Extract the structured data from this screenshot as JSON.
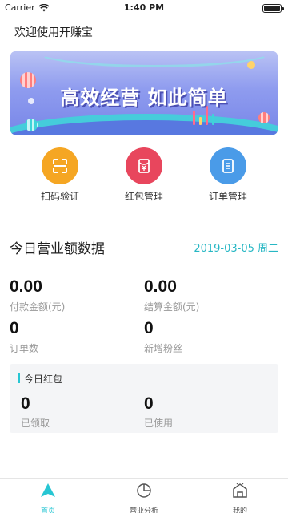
{
  "status_bar": {
    "carrier": "Carrier",
    "time": "1:40 PM"
  },
  "header": {
    "welcome": "欢迎使用开赚宝"
  },
  "banner": {
    "headline": "高效经营 如此简单"
  },
  "quick_actions": [
    {
      "label": "扫码验证",
      "icon": "scan-icon",
      "color": "#f5a623"
    },
    {
      "label": "红包管理",
      "icon": "red-packet-icon",
      "color": "#e8465d"
    },
    {
      "label": "订单管理",
      "icon": "order-list-icon",
      "color": "#4a9be8"
    }
  ],
  "today": {
    "title": "今日营业额数据",
    "date": "2019-03-05 周二",
    "stats": [
      {
        "value": "0.00",
        "label": "付款金额(元)"
      },
      {
        "value": "0.00",
        "label": "结算金额(元)"
      },
      {
        "value": "0",
        "label": "订单数"
      },
      {
        "value": "0",
        "label": "新增粉丝"
      }
    ]
  },
  "red_packet": {
    "title": "今日红包",
    "stats": [
      {
        "value": "0",
        "label": "已领取"
      },
      {
        "value": "0",
        "label": "已使用"
      }
    ]
  },
  "tabbar": {
    "items": [
      {
        "label": "首页",
        "icon": "home-icon",
        "active": true
      },
      {
        "label": "营业分析",
        "icon": "pie-chart-icon",
        "active": false
      },
      {
        "label": "我的",
        "icon": "shop-icon",
        "active": false
      }
    ]
  },
  "colors": {
    "accent": "#27c6d3",
    "date_text": "#27b7c4"
  }
}
